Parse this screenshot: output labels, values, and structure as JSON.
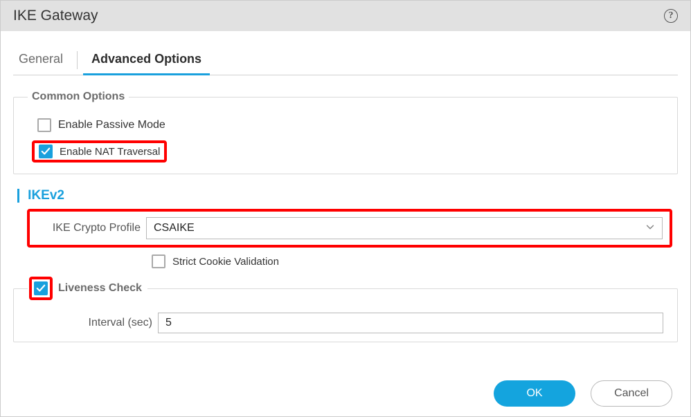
{
  "title": "IKE Gateway",
  "tabs": {
    "general": "General",
    "advanced": "Advanced Options"
  },
  "common": {
    "legend": "Common Options",
    "passive": {
      "label": "Enable Passive Mode",
      "checked": false
    },
    "nat": {
      "label": "Enable NAT Traversal",
      "checked": true
    }
  },
  "ikev2": {
    "heading": "IKEv2",
    "crypto_label": "IKE Crypto Profile",
    "crypto_value": "CSAIKE",
    "strict": {
      "label": "Strict Cookie Validation",
      "checked": false
    }
  },
  "liveness": {
    "legend": "Liveness Check",
    "checked": true,
    "interval_label": "Interval (sec)",
    "interval_value": "5"
  },
  "footer": {
    "ok": "OK",
    "cancel": "Cancel"
  }
}
